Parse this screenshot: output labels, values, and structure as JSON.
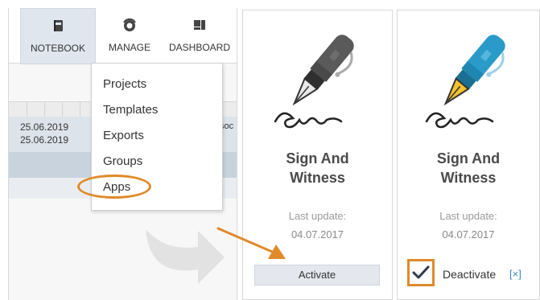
{
  "nav": {
    "notebook": "NOTEBOOK",
    "manage": "MANAGE",
    "dashboard": "DASHBOARD"
  },
  "table": {
    "rows": [
      {
        "date1": "25.06.2019",
        "date2": "25.06.2019",
        "truncated": "soc"
      }
    ]
  },
  "menu": {
    "items": [
      "Projects",
      "Templates",
      "Exports",
      "Groups",
      "Apps"
    ]
  },
  "cards": [
    {
      "title_line1": "Sign And",
      "title_line2": "Witness",
      "update_label": "Last update:",
      "update_date": "04.07.2017",
      "action_label": "Activate",
      "pen_color": "#5a5a5a"
    },
    {
      "title_line1": "Sign And",
      "title_line2": "Witness",
      "update_label": "Last update:",
      "update_date": "04.07.2017",
      "action_label": "Deactivate",
      "remove_label": "[×]",
      "pen_color": "#2a9bc9"
    }
  ],
  "colors": {
    "highlight": "#e08a2a",
    "link": "#3a86c8",
    "nav_active_bg": "#dfe6ee"
  },
  "icons": {
    "notebook": "notebook-icon",
    "manage": "gauge-icon",
    "dashboard": "dashboard-icon",
    "check": "checkmark-icon"
  }
}
